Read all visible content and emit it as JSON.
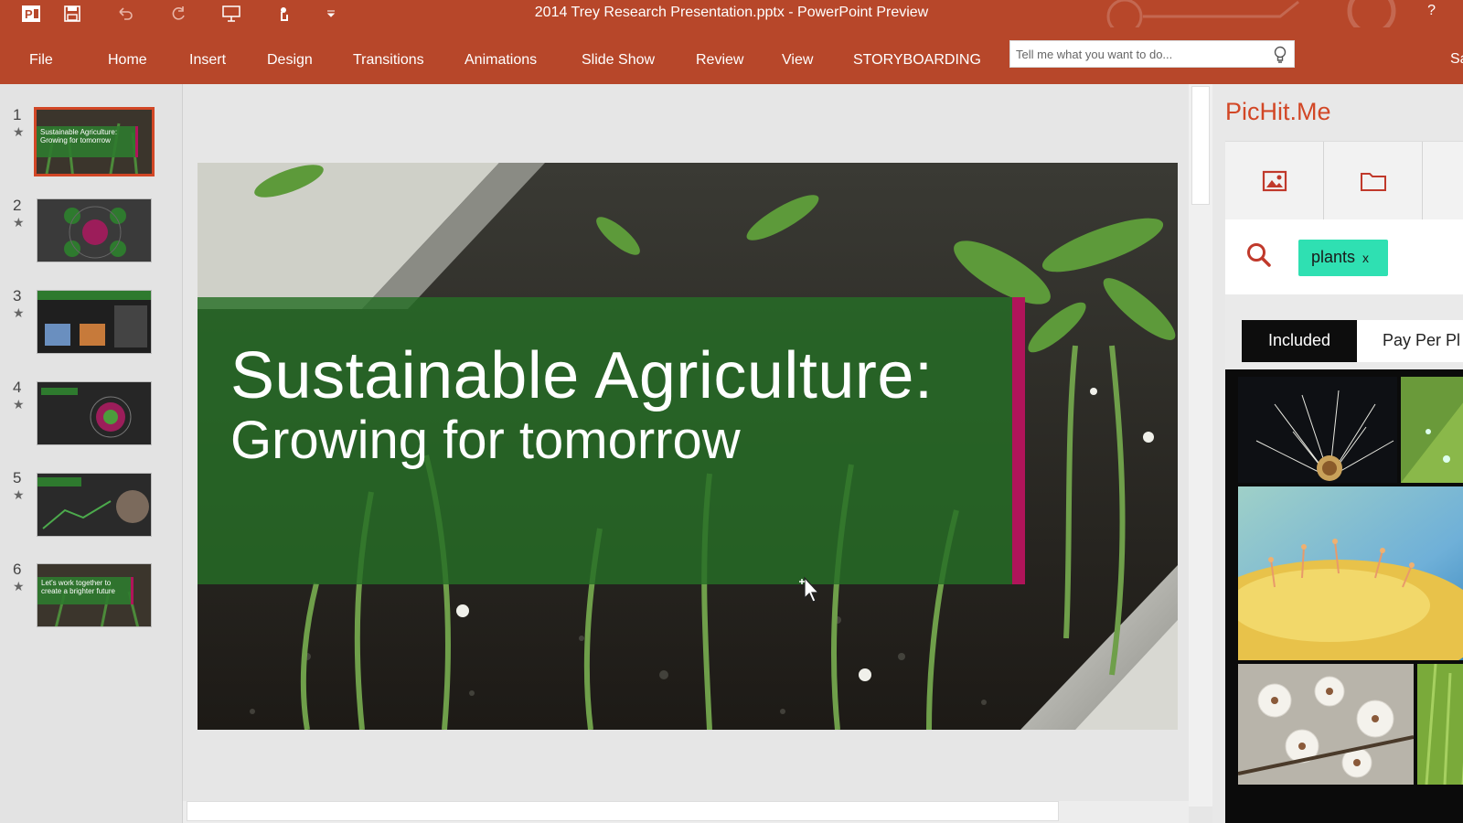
{
  "window": {
    "title": "2014 Trey Research Presentation.pptx - PowerPoint Preview",
    "help_label": "?"
  },
  "quick_access": [
    "app-logo",
    "save-icon",
    "undo-icon",
    "redo-icon",
    "presenter-icon",
    "touch-mode-icon",
    "customize-icon"
  ],
  "ribbon": {
    "tabs": [
      "File",
      "Home",
      "Insert",
      "Design",
      "Transitions",
      "Animations",
      "Slide Show",
      "Review",
      "View",
      "STORYBOARDING"
    ],
    "tell_me_placeholder": "Tell me what you want to do...",
    "share_label": "Sa"
  },
  "thumbnails": [
    {
      "number": "1",
      "caption": "Sustainable Agriculture: Growing for tomorrow",
      "selected": true
    },
    {
      "number": "2",
      "caption": "",
      "selected": false
    },
    {
      "number": "3",
      "caption": "",
      "selected": false
    },
    {
      "number": "4",
      "caption": "",
      "selected": false
    },
    {
      "number": "5",
      "caption": "",
      "selected": false
    },
    {
      "number": "6",
      "caption": "Let's work together to create a brighter future",
      "selected": false
    }
  ],
  "slide": {
    "title": "Sustainable Agriculture:",
    "subtitle": "Growing for tomorrow",
    "band_color": "#266e26",
    "accent_color": "#b0145a"
  },
  "pichit": {
    "title": "PicHit.Me",
    "search_tag": "plants",
    "remove_tag": "x",
    "tabs": [
      "Included",
      "Pay Per Pl"
    ],
    "active_tab": "Included"
  },
  "colors": {
    "ribbon": "#b7472a",
    "accent": "#d24726",
    "tag": "#2fe0b2"
  }
}
